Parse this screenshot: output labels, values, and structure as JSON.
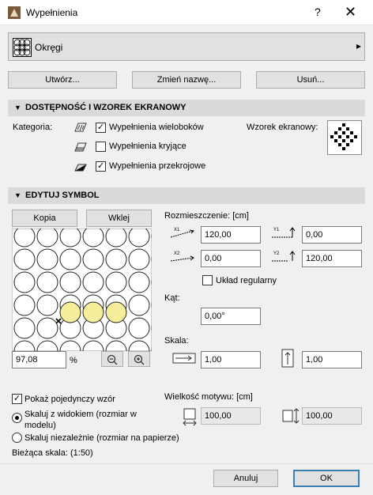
{
  "window": {
    "title": "Wypełnienia",
    "help": "?",
    "close": "✕"
  },
  "fill": {
    "name": "Okręgi",
    "arrow": "▸"
  },
  "toolbar": {
    "create": "Utwórz...",
    "rename": "Zmień nazwę...",
    "delete": "Usuń..."
  },
  "availability": {
    "header": "DOSTĘPNOŚĆ I WZOREK EKRANOWY",
    "category_label": "Kategoria:",
    "categories": [
      {
        "label": "Wypełnienia wieloboków",
        "checked": true
      },
      {
        "label": "Wypełnienia kryjące",
        "checked": false
      },
      {
        "label": "Wypełnienia przekrojowe",
        "checked": true
      }
    ],
    "screen_pattern_label": "Wzorek ekranowy:"
  },
  "symbol": {
    "header": "EDYTUJ SYMBOL",
    "copy": "Kopia",
    "paste": "Wklej",
    "zoom_value": "97,08",
    "zoom_unit": "%",
    "show_single": "Pokaż pojedynczy wzór",
    "scale_with_view": "Skaluj z widokiem (rozmiar w modelu)",
    "scale_independent": "Skaluj niezależnie (rozmiar na papierze)",
    "current_scale": "Bieżąca skala: (1:50)",
    "layout_label": "Rozmieszczenie: [cm]",
    "x1_icon": "X1",
    "y1_icon": "Y1",
    "x2_icon": "X2",
    "y2_icon": "Y2",
    "x1": "120,00",
    "y1": "0,00",
    "x2": "0,00",
    "y2": "120,00",
    "regular_layout": "Układ regularny",
    "angle_label": "Kąt:",
    "angle": "0,00°",
    "scale_label": "Skala:",
    "scale_x": "1,00",
    "scale_y": "1,00",
    "motif_size_label": "Wielkość motywu: [cm]",
    "motif_w": "100,00",
    "motif_h": "100,00"
  },
  "footer": {
    "cancel": "Anuluj",
    "ok": "OK"
  }
}
